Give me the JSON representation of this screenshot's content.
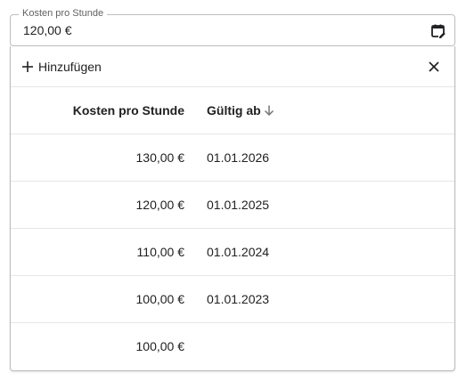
{
  "field": {
    "label": "Kosten pro Stunde",
    "value": "120,00 €",
    "icon": "calendar-edit-icon"
  },
  "panel": {
    "add_label": "Hinzufügen",
    "add_icon": "plus-icon",
    "close_icon": "close-icon"
  },
  "table": {
    "headers": {
      "cost": "Kosten pro Stunde",
      "valid_from": "Gültig ab",
      "sort_icon": "arrow-down-icon"
    },
    "rows": [
      {
        "cost": "130,00 €",
        "valid_from": "01.01.2026"
      },
      {
        "cost": "120,00 €",
        "valid_from": "01.01.2025"
      },
      {
        "cost": "110,00 €",
        "valid_from": "01.01.2024"
      },
      {
        "cost": "100,00 €",
        "valid_from": "01.01.2023"
      },
      {
        "cost": "100,00 €",
        "valid_from": ""
      }
    ]
  },
  "colors": {
    "border": "#bdbdbd",
    "divider": "#e6e6e6",
    "text": "#202124",
    "label": "#616161"
  }
}
